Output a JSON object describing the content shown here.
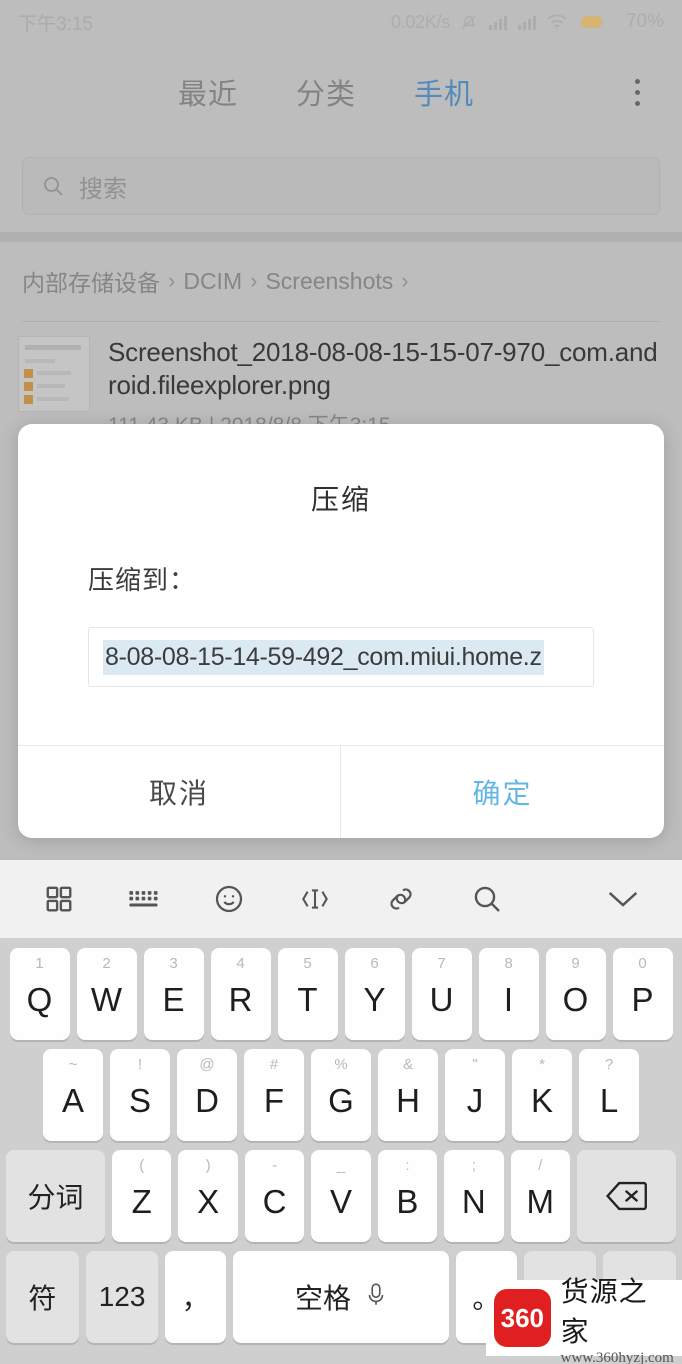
{
  "status_bar": {
    "time": "下午3:15",
    "network_speed": "0.02K/s",
    "battery_percent": "70%",
    "icons": [
      "mute-bell-icon",
      "signal-bars-icon",
      "signal-bars-icon",
      "wifi-icon",
      "battery-icon"
    ]
  },
  "tabs": {
    "items": [
      {
        "label": "最近",
        "active": false
      },
      {
        "label": "分类",
        "active": false
      },
      {
        "label": "手机",
        "active": true
      }
    ],
    "overflow_label": "more-options",
    "active_color": "#5a93c7",
    "inactive_color": "#8c8c8c"
  },
  "search": {
    "placeholder": "搜索",
    "icon": "search-icon"
  },
  "breadcrumb": {
    "items": [
      "内部存储设备",
      "DCIM",
      "Screenshots"
    ],
    "separator": "›"
  },
  "file_list": [
    {
      "name": "Screenshot_2018-08-08-15-15-07-970_com.android.fileexplorer.png",
      "size": "111.43 KB",
      "separator": "|",
      "date": "2018/8/8 下午3:15"
    }
  ],
  "dialog": {
    "title": "压缩",
    "label": "压缩到：",
    "input_value": "8-08-08-15-14-59-492_com.miui.home.z",
    "selection_color": "#dbe9f3",
    "cancel_label": "取消",
    "confirm_label": "确定",
    "confirm_color": "#63b6e5"
  },
  "keyboard": {
    "toolbar_icons": [
      "grid-icon",
      "keyboard-icon",
      "emoji-icon",
      "text-cursor-icon",
      "clipboard-link-icon",
      "search-icon",
      "chevron-down-icon"
    ],
    "row1": [
      {
        "main": "Q",
        "alt": "1"
      },
      {
        "main": "W",
        "alt": "2"
      },
      {
        "main": "E",
        "alt": "3"
      },
      {
        "main": "R",
        "alt": "4"
      },
      {
        "main": "T",
        "alt": "5"
      },
      {
        "main": "Y",
        "alt": "6"
      },
      {
        "main": "U",
        "alt": "7"
      },
      {
        "main": "I",
        "alt": "8"
      },
      {
        "main": "O",
        "alt": "9"
      },
      {
        "main": "P",
        "alt": "0"
      }
    ],
    "row2": [
      {
        "main": "A",
        "alt": "~"
      },
      {
        "main": "S",
        "alt": "!"
      },
      {
        "main": "D",
        "alt": "@"
      },
      {
        "main": "F",
        "alt": "#"
      },
      {
        "main": "G",
        "alt": "%"
      },
      {
        "main": "H",
        "alt": "&"
      },
      {
        "main": "J",
        "alt": "\""
      },
      {
        "main": "K",
        "alt": "*"
      },
      {
        "main": "L",
        "alt": "?"
      }
    ],
    "row3_fn_left": "分词",
    "row3": [
      {
        "main": "Z",
        "alt": "("
      },
      {
        "main": "X",
        "alt": ")"
      },
      {
        "main": "C",
        "alt": "-"
      },
      {
        "main": "V",
        "alt": "_"
      },
      {
        "main": "B",
        "alt": ":"
      },
      {
        "main": "N",
        "alt": ";"
      },
      {
        "main": "M",
        "alt": "/"
      }
    ],
    "row3_fn_right": "backspace-icon",
    "row4": {
      "symbol_label": "符",
      "number_label": "123",
      "comma_label": "，",
      "space_label": "空格",
      "mic_icon": "microphone-icon",
      "period_label": "。"
    }
  },
  "watermark": {
    "logo_text": "360",
    "brand": "货源之家",
    "url": "www.360hyzj.com",
    "logo_color": "#e02020"
  }
}
